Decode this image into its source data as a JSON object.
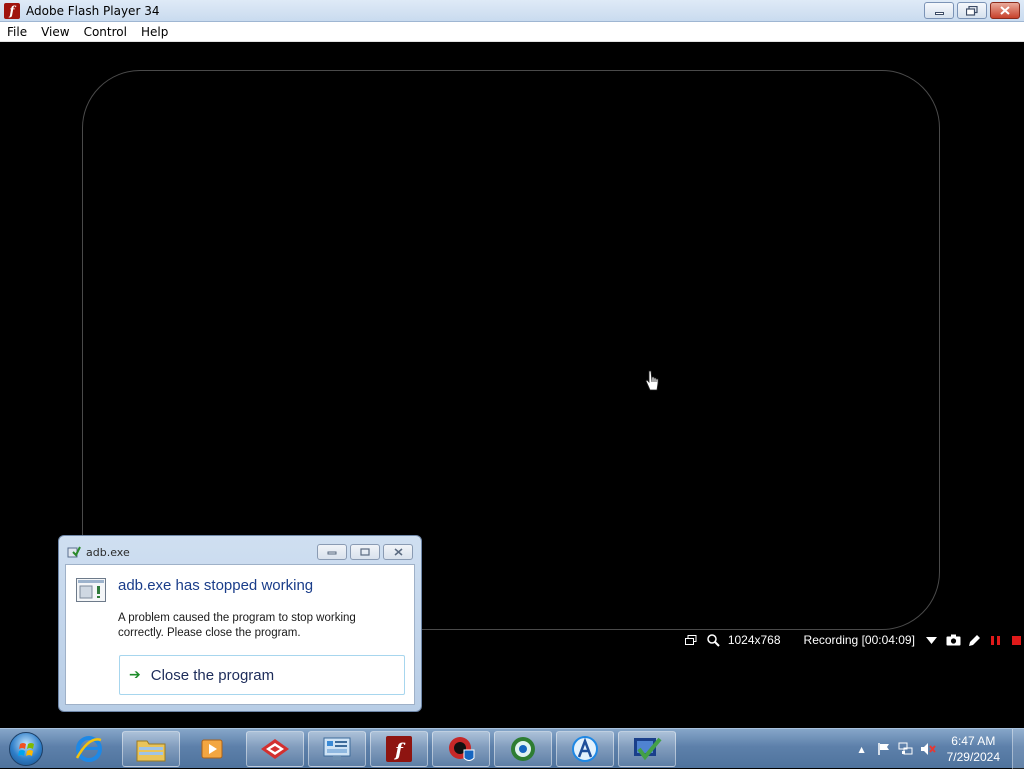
{
  "window": {
    "title": "Adobe Flash Player 34",
    "app_icon_glyph": "f"
  },
  "menu": {
    "items": [
      "File",
      "View",
      "Control",
      "Help"
    ]
  },
  "recording_bar": {
    "resolution": "1024x768",
    "status": "Recording [00:04:09]",
    "icons": [
      "window-icon",
      "zoom-icon",
      "dropdown-arrow-icon",
      "camera-icon",
      "pencil-icon",
      "pause-icon",
      "stop-icon"
    ]
  },
  "dialog": {
    "title": "adb.exe",
    "heading": "adb.exe has stopped working",
    "message": "A problem caused the program to stop working correctly. Please close the program.",
    "action_label": "Close the program",
    "action_arrow": "➔"
  },
  "taskbar": {
    "pinned": [
      "internet-explorer-icon",
      "file-explorer-icon",
      "media-player-icon",
      "app-red-icon",
      "control-panel-icon",
      "flash-player-icon",
      "app-shield-icon",
      "app-globe-icon",
      "app-a-icon",
      "app-check-icon"
    ]
  },
  "tray": {
    "overflow_arrow": "▲",
    "time": "6:47 AM",
    "date": "7/29/2024"
  },
  "colors": {
    "dialog_heading": "#1a3d8a",
    "action_arrow": "#1e8c2a",
    "stop_red": "#e01a1a"
  }
}
